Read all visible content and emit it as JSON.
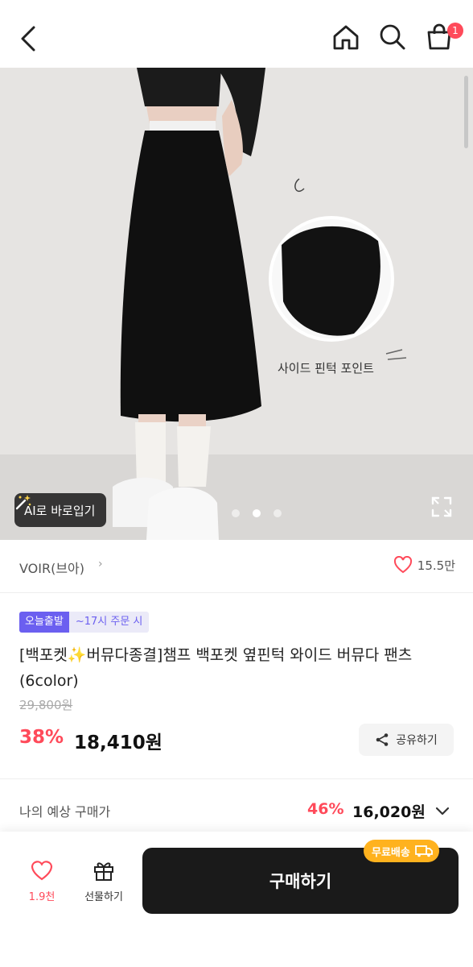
{
  "header": {
    "cart_count": "1",
    "icons": [
      "back-icon",
      "home-icon",
      "search-icon",
      "shopping-bag-icon"
    ]
  },
  "hero": {
    "overlay_text": "사이드 핀턱 포인트",
    "ai_button_label": "AI로 바로입기",
    "slide_count": 3,
    "active_slide": 2
  },
  "brand": {
    "name": "VOIR(브아)",
    "chevron": "›",
    "like_count": "15.5만"
  },
  "product": {
    "badge_today": "오늘출발",
    "badge_order": "~17시 주문 시",
    "title": "[백포켓✨버뮤다종결]챔프 백포켓 옆핀턱 와이드 버뮤다 팬츠(6color)",
    "original_price": "29,800원",
    "discount_rate": "38%",
    "price": "18,410원",
    "share_label": "공유하기"
  },
  "expected": {
    "label": "나의 예상 구매가",
    "discount_rate": "46%",
    "price": "16,020원"
  },
  "bottom_bar": {
    "wish_count": "1.9천",
    "gift_label": "선물하기",
    "buy_label": "구매하기",
    "shipping_tag": "무료배송"
  },
  "colors": {
    "accent_red": "#ff4a5a",
    "badge_purple": "#6b5ff0",
    "buy_button": "#1a1a1a",
    "shipping_tag": "#ffb21e"
  }
}
